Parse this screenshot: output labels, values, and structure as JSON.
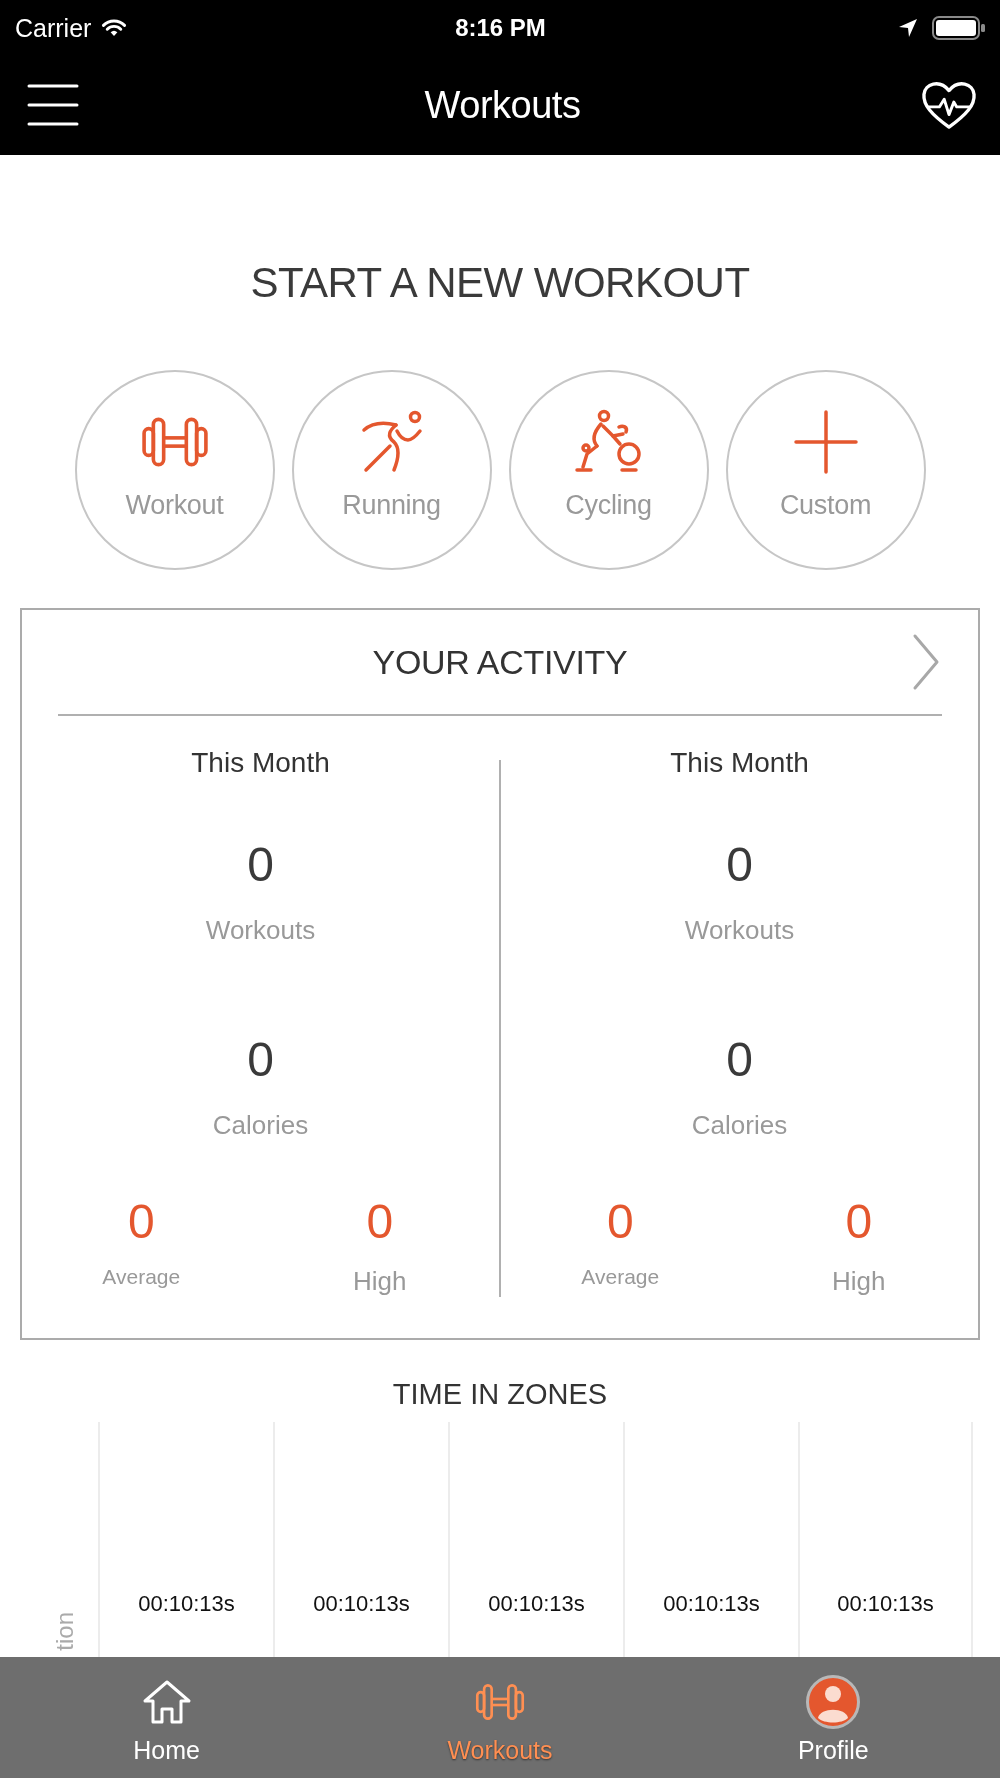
{
  "status_bar": {
    "carrier": "Carrier",
    "time": "8:16 PM"
  },
  "nav_bar": {
    "title": "Workouts"
  },
  "start_section": {
    "title": "START A NEW WORKOUT",
    "options": [
      {
        "label": "Workout",
        "kind": "dumbbell"
      },
      {
        "label": "Running",
        "kind": "runner"
      },
      {
        "label": "Cycling",
        "kind": "cyclist"
      },
      {
        "label": "Custom",
        "kind": "plus"
      }
    ]
  },
  "activity": {
    "title": "YOUR ACTIVITY",
    "columns": [
      {
        "period": "This Month",
        "stats": [
          {
            "value": "0",
            "label": "Workouts"
          },
          {
            "value": "0",
            "label": "Calories"
          }
        ],
        "records": [
          {
            "value": "0",
            "label": "Average",
            "kind": "average"
          },
          {
            "value": "0",
            "label": "High",
            "kind": "high"
          }
        ]
      },
      {
        "period": "This Month",
        "stats": [
          {
            "value": "0",
            "label": "Workouts"
          },
          {
            "value": "0",
            "label": "Calories"
          }
        ],
        "records": [
          {
            "value": "0",
            "label": "Average",
            "kind": "average"
          },
          {
            "value": "0",
            "label": "High",
            "kind": "high"
          }
        ]
      }
    ]
  },
  "time_in_zones": {
    "title": "TIME IN ZONES",
    "axis_label": "tion",
    "zones": [
      {
        "time": "00:10:13s"
      },
      {
        "time": "00:10:13s"
      },
      {
        "time": "00:10:13s"
      },
      {
        "time": "00:10:13s"
      },
      {
        "time": "00:10:13s"
      }
    ]
  },
  "tab_bar": {
    "tabs": [
      {
        "label": "Home",
        "kind": "home",
        "selected": false
      },
      {
        "label": "Workouts",
        "kind": "dumbbell",
        "selected": true
      },
      {
        "label": "Profile",
        "kind": "avatar",
        "selected": false
      }
    ]
  }
}
